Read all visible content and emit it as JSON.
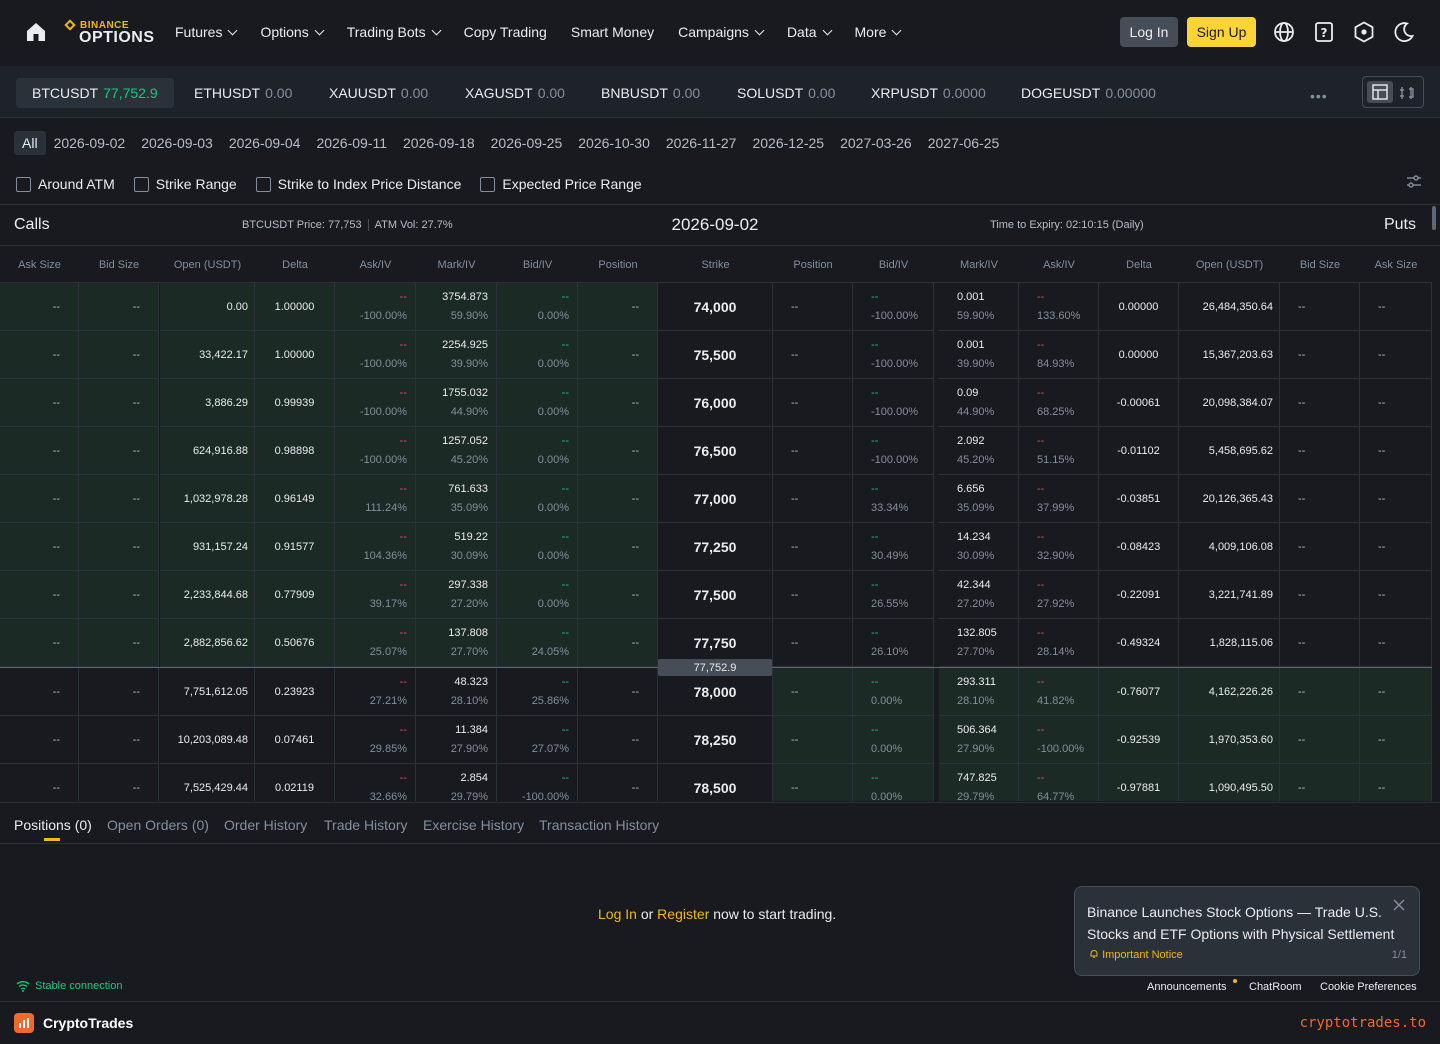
{
  "nav": {
    "logo_top": "BINANCE",
    "logo_bottom": "OPTIONS",
    "items": [
      {
        "label": "Futures",
        "dropdown": true
      },
      {
        "label": "Options",
        "dropdown": true
      },
      {
        "label": "Trading Bots",
        "dropdown": true
      },
      {
        "label": "Copy Trading",
        "dropdown": false
      },
      {
        "label": "Smart Money",
        "dropdown": false
      },
      {
        "label": "Campaigns",
        "dropdown": true
      },
      {
        "label": "Data",
        "dropdown": true
      },
      {
        "label": "More",
        "dropdown": true
      }
    ],
    "login": "Log In",
    "signup": "Sign Up"
  },
  "symbols": [
    {
      "name": "BTCUSDT",
      "price": "77,752.9",
      "active": true
    },
    {
      "name": "ETHUSDT",
      "price": "0.00"
    },
    {
      "name": "XAUUSDT",
      "price": "0.00"
    },
    {
      "name": "XAGUSDT",
      "price": "0.00"
    },
    {
      "name": "BNBUSDT",
      "price": "0.00"
    },
    {
      "name": "SOLUSDT",
      "price": "0.00"
    },
    {
      "name": "XRPUSDT",
      "price": "0.0000"
    },
    {
      "name": "DOGEUSDT",
      "price": "0.00000"
    }
  ],
  "more_dots": "•••",
  "date_tabs": [
    "All",
    "2026-09-02",
    "2026-09-03",
    "2026-09-04",
    "2026-09-11",
    "2026-09-18",
    "2026-09-25",
    "2026-10-30",
    "2026-11-27",
    "2026-12-25",
    "2027-03-26",
    "2027-06-25"
  ],
  "filters": [
    "Around ATM",
    "Strike Range",
    "Strike to Index Price Distance",
    "Expected Price Range"
  ],
  "chain": {
    "calls": "Calls",
    "puts": "Puts",
    "index_price": "BTCUSDT Price: 77,753",
    "atm_vol": "ATM Vol: 27.7%",
    "expiry": "2026-09-02",
    "time_to_expiry": "Time to Expiry: 02:10:15 (Daily)",
    "current_price": "77,752.9"
  },
  "columns": {
    "call": [
      "Ask Size",
      "Bid Size",
      "Open (USDT)",
      "Delta",
      "Ask/IV",
      "Mark/IV",
      "Bid/IV",
      "Position"
    ],
    "strike": "Strike",
    "put": [
      "Position",
      "Bid/IV",
      "Mark/IV",
      "Ask/IV",
      "Delta",
      "Open (USDT)",
      "Bid Size",
      "Ask Size"
    ]
  },
  "rows": [
    {
      "strike": "74,000",
      "c_open": "0.00",
      "c_delta": "1.00000",
      "c_ask": "--",
      "c_ask_iv": "-100.00%",
      "c_mark": "3754.873",
      "c_mark_iv": "59.90%",
      "c_bid": "--",
      "c_bid_iv": "0.00%",
      "p_bid": "--",
      "p_bid_iv": "-100.00%",
      "p_mark": "0.001",
      "p_mark_iv": "59.90%",
      "p_ask": "--",
      "p_ask_iv": "133.60%",
      "p_delta": "0.00000",
      "p_open": "26,484,350.64"
    },
    {
      "strike": "75,500",
      "c_open": "33,422.17",
      "c_delta": "1.00000",
      "c_ask": "--",
      "c_ask_iv": "-100.00%",
      "c_mark": "2254.925",
      "c_mark_iv": "39.90%",
      "c_bid": "--",
      "c_bid_iv": "0.00%",
      "p_bid": "--",
      "p_bid_iv": "-100.00%",
      "p_mark": "0.001",
      "p_mark_iv": "39.90%",
      "p_ask": "--",
      "p_ask_iv": "84.93%",
      "p_delta": "0.00000",
      "p_open": "15,367,203.63"
    },
    {
      "strike": "76,000",
      "c_open": "3,886.29",
      "c_delta": "0.99939",
      "c_ask": "--",
      "c_ask_iv": "-100.00%",
      "c_mark": "1755.032",
      "c_mark_iv": "44.90%",
      "c_bid": "--",
      "c_bid_iv": "0.00%",
      "p_bid": "--",
      "p_bid_iv": "-100.00%",
      "p_mark": "0.09",
      "p_mark_iv": "44.90%",
      "p_ask": "--",
      "p_ask_iv": "68.25%",
      "p_delta": "-0.00061",
      "p_open": "20,098,384.07"
    },
    {
      "strike": "76,500",
      "c_open": "624,916.88",
      "c_delta": "0.98898",
      "c_ask": "--",
      "c_ask_iv": "-100.00%",
      "c_mark": "1257.052",
      "c_mark_iv": "45.20%",
      "c_bid": "--",
      "c_bid_iv": "0.00%",
      "p_bid": "--",
      "p_bid_iv": "-100.00%",
      "p_mark": "2.092",
      "p_mark_iv": "45.20%",
      "p_ask": "--",
      "p_ask_iv": "51.15%",
      "p_delta": "-0.01102",
      "p_open": "5,458,695.62"
    },
    {
      "strike": "77,000",
      "c_open": "1,032,978.28",
      "c_delta": "0.96149",
      "c_ask": "--",
      "c_ask_iv": "111.24%",
      "c_mark": "761.633",
      "c_mark_iv": "35.09%",
      "c_bid": "--",
      "c_bid_iv": "0.00%",
      "p_bid": "--",
      "p_bid_iv": "33.34%",
      "p_mark": "6.656",
      "p_mark_iv": "35.09%",
      "p_ask": "--",
      "p_ask_iv": "37.99%",
      "p_delta": "-0.03851",
      "p_open": "20,126,365.43"
    },
    {
      "strike": "77,250",
      "c_open": "931,157.24",
      "c_delta": "0.91577",
      "c_ask": "--",
      "c_ask_iv": "104.36%",
      "c_mark": "519.22",
      "c_mark_iv": "30.09%",
      "c_bid": "--",
      "c_bid_iv": "0.00%",
      "p_bid": "--",
      "p_bid_iv": "30.49%",
      "p_mark": "14.234",
      "p_mark_iv": "30.09%",
      "p_ask": "--",
      "p_ask_iv": "32.90%",
      "p_delta": "-0.08423",
      "p_open": "4,009,106.08"
    },
    {
      "strike": "77,500",
      "c_open": "2,233,844.68",
      "c_delta": "0.77909",
      "c_ask": "--",
      "c_ask_iv": "39.17%",
      "c_mark": "297.338",
      "c_mark_iv": "27.20%",
      "c_bid": "--",
      "c_bid_iv": "0.00%",
      "p_bid": "--",
      "p_bid_iv": "26.55%",
      "p_mark": "42.344",
      "p_mark_iv": "27.20%",
      "p_ask": "--",
      "p_ask_iv": "27.92%",
      "p_delta": "-0.22091",
      "p_open": "3,221,741.89"
    },
    {
      "strike": "77,750",
      "c_open": "2,882,856.62",
      "c_delta": "0.50676",
      "c_ask": "--",
      "c_ask_iv": "25.07%",
      "c_mark": "137.808",
      "c_mark_iv": "27.70%",
      "c_bid": "--",
      "c_bid_iv": "24.05%",
      "p_bid": "--",
      "p_bid_iv": "26.10%",
      "p_mark": "132.805",
      "p_mark_iv": "27.70%",
      "p_ask": "--",
      "p_ask_iv": "28.14%",
      "p_delta": "-0.49324",
      "p_open": "1,828,115.06"
    },
    {
      "strike": "78,000",
      "c_open": "7,751,612.05",
      "c_delta": "0.23923",
      "c_ask": "--",
      "c_ask_iv": "27.21%",
      "c_mark": "48.323",
      "c_mark_iv": "28.10%",
      "c_bid": "--",
      "c_bid_iv": "25.86%",
      "p_bid": "--",
      "p_bid_iv": "0.00%",
      "p_mark": "293.311",
      "p_mark_iv": "28.10%",
      "p_ask": "--",
      "p_ask_iv": "41.82%",
      "p_delta": "-0.76077",
      "p_open": "4,162,226.26"
    },
    {
      "strike": "78,250",
      "c_open": "10,203,089.48",
      "c_delta": "0.07461",
      "c_ask": "--",
      "c_ask_iv": "29.85%",
      "c_mark": "11.384",
      "c_mark_iv": "27.90%",
      "c_bid": "--",
      "c_bid_iv": "27.07%",
      "p_bid": "--",
      "p_bid_iv": "0.00%",
      "p_mark": "506.364",
      "p_mark_iv": "27.90%",
      "p_ask": "--",
      "p_ask_iv": "-100.00%",
      "p_delta": "-0.92539",
      "p_open": "1,970,353.60"
    },
    {
      "strike": "78,500",
      "c_open": "7,525,429.44",
      "c_delta": "0.02119",
      "c_ask": "--",
      "c_ask_iv": "32.66%",
      "c_mark": "2.854",
      "c_mark_iv": "29.79%",
      "c_bid": "--",
      "c_bid_iv": "-100.00%",
      "p_bid": "--",
      "p_bid_iv": "0.00%",
      "p_mark": "747.825",
      "p_mark_iv": "29.79%",
      "p_ask": "--",
      "p_ask_iv": "64.77%",
      "p_delta": "-0.97881",
      "p_open": "1,090,495.50"
    }
  ],
  "empty_cell": "--",
  "bottom_tabs": [
    "Positions (0)",
    "Open Orders (0)",
    "Order History",
    "Trade History",
    "Exercise History",
    "Transaction History"
  ],
  "trade_msg": {
    "login": "Log In",
    "or": "or",
    "register": "Register",
    "rest": "now to start trading."
  },
  "notice": {
    "title": "Binance Launches Stock Options — Trade U.S. Stocks and ETF Options with Physical Settlement",
    "tag": "Important Notice",
    "page": "1/1"
  },
  "footer": {
    "status": "Stable connection",
    "links": [
      "Announcements",
      "ChatRoom",
      "Cookie Preferences"
    ]
  },
  "watermark": {
    "name": "CryptoTrades",
    "url": "cryptotrades.to"
  },
  "colors": {
    "accent": "#f0b90b",
    "up": "#0ecb81",
    "down": "#f6465d",
    "itm_bg": "#1c2a26"
  }
}
